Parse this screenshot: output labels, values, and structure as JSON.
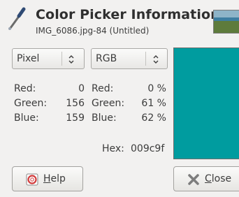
{
  "header": {
    "title": "Color Picker Information",
    "subtitle": "IMG_6086.jpg-84 (Untitled)"
  },
  "left_panel": {
    "mode": "Pixel",
    "rows": [
      {
        "label": "Red:",
        "value": "0"
      },
      {
        "label": "Green:",
        "value": "156"
      },
      {
        "label": "Blue:",
        "value": "159"
      }
    ]
  },
  "right_panel": {
    "mode": "RGB",
    "rows": [
      {
        "label": "Red:",
        "value": "0 %"
      },
      {
        "label": "Green:",
        "value": "61 %"
      },
      {
        "label": "Blue:",
        "value": "62 %"
      }
    ],
    "hex_label": "Hex:",
    "hex_value": "009c9f"
  },
  "swatch": {
    "color": "#009c9f"
  },
  "buttons": {
    "help_mnemonic": "H",
    "help_rest": "elp",
    "close_mnemonic": "C",
    "close_rest": "lose"
  },
  "icons": {
    "picker": "color-picker-icon",
    "help": "help-icon",
    "close": "close-icon",
    "combo": "chevron-updown-icon"
  }
}
